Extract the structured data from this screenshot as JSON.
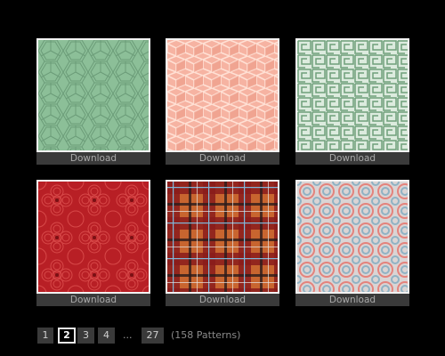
{
  "gallery": {
    "items": [
      {
        "pattern": "green-hexagonal-weave",
        "download_label": "Download",
        "colors": {
          "bg": "#8cbf98",
          "line": "#6fa07c"
        }
      },
      {
        "pattern": "peach-cube-lattice",
        "download_label": "Download",
        "colors": {
          "bg": "#f6b3a2",
          "line": "#ffd9cc"
        }
      },
      {
        "pattern": "green-fret-maze",
        "download_label": "Download",
        "colors": {
          "bg": "#d9eadc",
          "line": "#6f9f7a"
        }
      },
      {
        "pattern": "red-quatrefoil",
        "download_label": "Download",
        "colors": {
          "bg": "#b81f25",
          "line": "#d84a4a"
        }
      },
      {
        "pattern": "tartan-plaid",
        "download_label": "Download",
        "colors": {
          "bg": "#c2622f",
          "line": "#8a1a1a"
        }
      },
      {
        "pattern": "pastel-circles",
        "download_label": "Download",
        "colors": {
          "bg": "#d9d3d3",
          "line": "#e4837c"
        }
      }
    ]
  },
  "pagination": {
    "pages": [
      {
        "label": "1",
        "active": false
      },
      {
        "label": "2",
        "active": true
      },
      {
        "label": "3",
        "active": false
      },
      {
        "label": "4",
        "active": false
      }
    ],
    "ellipsis": "...",
    "last_page": "27",
    "count_text": "(158 Patterns)"
  }
}
